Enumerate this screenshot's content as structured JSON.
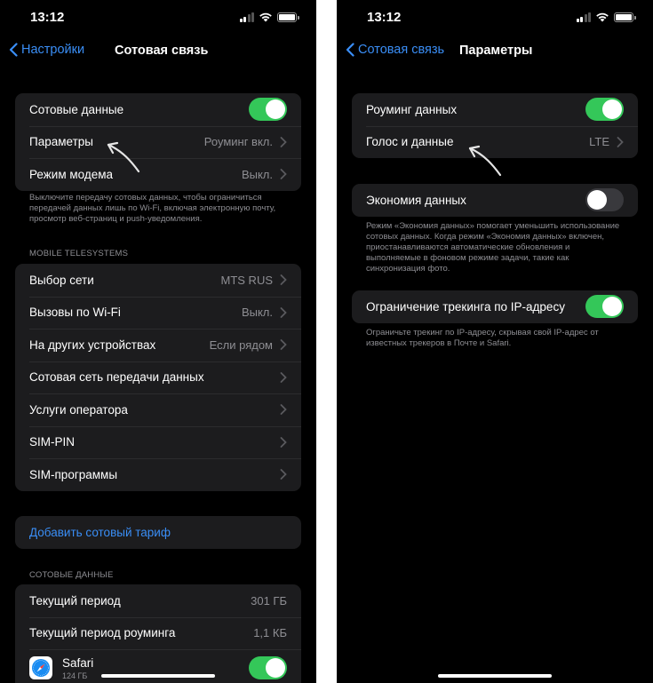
{
  "left": {
    "status": {
      "time": "13:12"
    },
    "nav": {
      "back_label": "Настройки",
      "title": "Сотовая связь"
    },
    "cellular": {
      "data_label": "Сотовые данные",
      "data_on": true,
      "options_label": "Параметры",
      "options_value": "Роуминг вкл.",
      "modem_label": "Режим модема",
      "modem_value": "Выкл."
    },
    "cellular_footnote": "Выключите передачу сотовых данных, чтобы ограничиться передачей данных лишь по Wi-Fi, включая электронную почту, просмотр веб-страниц и push-уведомления.",
    "carrier_header": "MOBILE TELESYSTEMS",
    "carrier": [
      {
        "label": "Выбор сети",
        "value": "MTS RUS"
      },
      {
        "label": "Вызовы по Wi-Fi",
        "value": "Выкл."
      },
      {
        "label": "На других устройствах",
        "value": "Если рядом"
      },
      {
        "label": "Сотовая сеть передачи данных",
        "value": ""
      },
      {
        "label": "Услуги оператора",
        "value": ""
      },
      {
        "label": "SIM-PIN",
        "value": ""
      },
      {
        "label": "SIM-программы",
        "value": ""
      }
    ],
    "add_plan_label": "Добавить сотовый тариф",
    "usage_header": "СОТОВЫЕ ДАННЫЕ",
    "usage": {
      "current_period_label": "Текущий период",
      "current_period_value": "301 ГБ",
      "roaming_period_label": "Текущий период роуминга",
      "roaming_period_value": "1,1 КБ",
      "app_name": "Safari",
      "app_size": "124 ГБ",
      "app_on": true,
      "app_icon": "safari-compass-icon"
    }
  },
  "right": {
    "status": {
      "time": "13:12"
    },
    "nav": {
      "back_label": "Сотовая связь",
      "title": "Параметры"
    },
    "roaming_label": "Роуминг данных",
    "roaming_on": true,
    "voice_label": "Голос и данные",
    "voice_value": "LTE",
    "lowdata_label": "Экономия данных",
    "lowdata_on": false,
    "lowdata_footnote": "Режим «Экономия данных» помогает уменьшить использование сотовых данных. Когда режим «Экономия данных» включен, приостанавливаются автоматические обновления и выполняемые в фоновом режиме задачи, такие как синхронизация фото.",
    "iptracking_label": "Ограничение трекинга по IP-адресу",
    "iptracking_on": true,
    "iptracking_footnote": "Ограничьте трекинг по IP-адресу, скрывая свой IP-адрес от известных трекеров в Почте и Safari."
  },
  "colors": {
    "accent": "#3a8ef6",
    "toggle_on": "#34c759",
    "group_bg": "#1c1c1e",
    "secondary_text": "#8e8e93"
  }
}
